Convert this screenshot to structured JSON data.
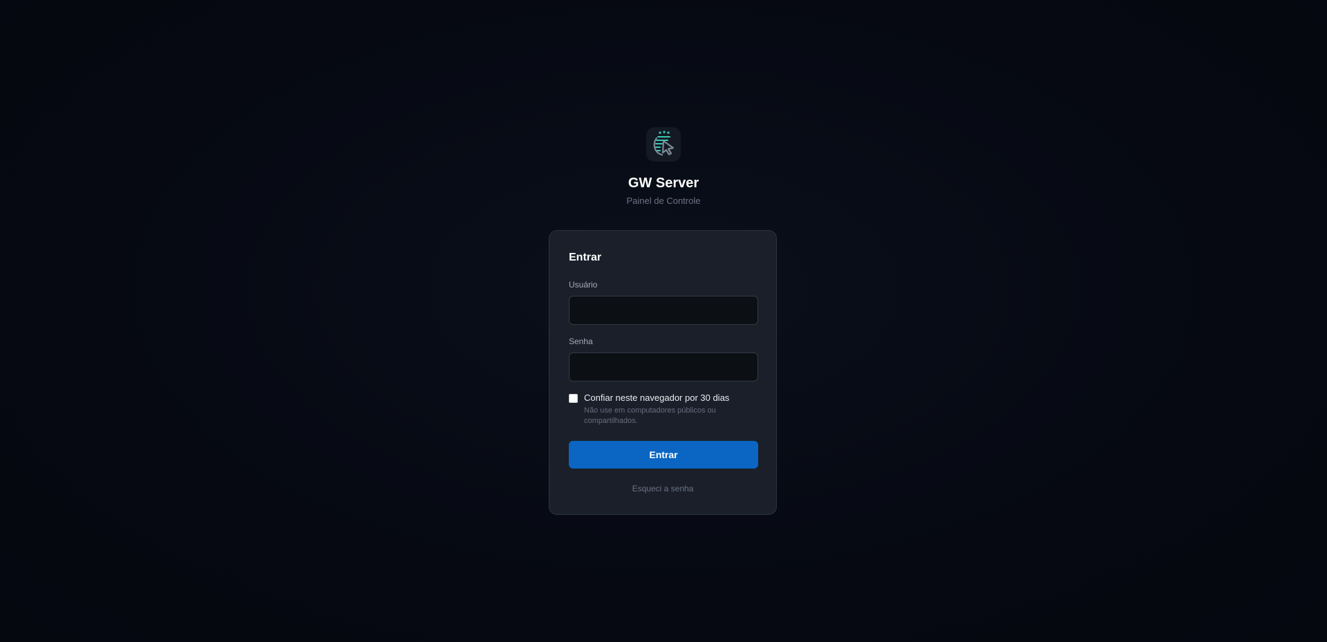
{
  "app": {
    "title": "GW Server",
    "subtitle": "Painel de Controle",
    "logo_icon": "cursor-click-icon"
  },
  "login": {
    "heading": "Entrar",
    "username": {
      "label": "Usuário",
      "value": "",
      "placeholder": ""
    },
    "password": {
      "label": "Senha",
      "value": "",
      "placeholder": ""
    },
    "trust_browser": {
      "label": "Confiar neste navegador por 30 dias",
      "hint": "Não use em computadores públicos ou compartilhados.",
      "checked": false
    },
    "submit_label": "Entrar",
    "forgot_label": "Esqueci a senha"
  },
  "colors": {
    "background": "#060912",
    "card": "#1a1f2a",
    "accent": "#0a66c2",
    "logo_teal": "#3cc8b4",
    "logo_gray": "#7d8896"
  }
}
